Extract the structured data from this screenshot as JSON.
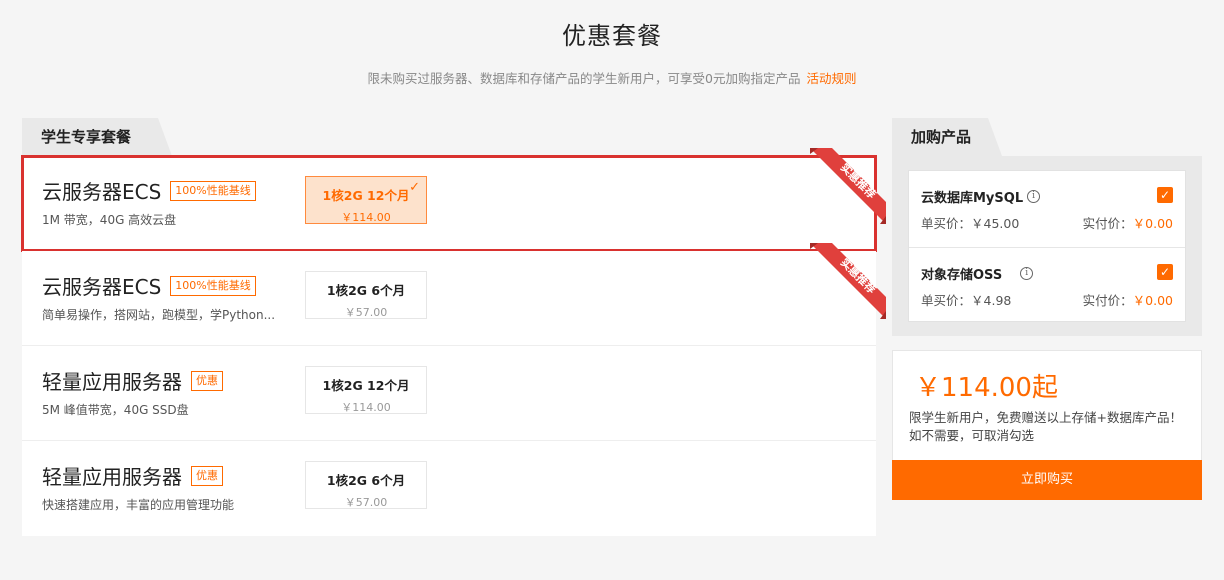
{
  "header": {
    "title": "优惠套餐",
    "subtitle": "限未购买过服务器、数据库和存储产品的学生新用户，可享受0元加购指定产品",
    "rules_link": "活动规则"
  },
  "left": {
    "tab_label": "学生专享套餐",
    "ribbon_text": "实惠推荐",
    "packages": [
      {
        "name": "云服务器ECS",
        "badge": "100%性能基线",
        "desc": "1M 带宽，40G 高效云盘",
        "spec_label": "1核2G 12个月",
        "spec_price": "￥114.00",
        "selected": true
      },
      {
        "name": "云服务器ECS",
        "badge": "100%性能基线",
        "desc": "简单易操作，搭网站，跑模型，学Python...",
        "spec_label": "1核2G 6个月",
        "spec_price": "￥57.00",
        "selected": false
      },
      {
        "name": "轻量应用服务器",
        "badge": "优惠",
        "desc": "5M 峰值带宽，40G SSD盘",
        "spec_label": "1核2G 12个月",
        "spec_price": "￥114.00",
        "selected": false
      },
      {
        "name": "轻量应用服务器",
        "badge": "优惠",
        "desc": "快速搭建应用，丰富的应用管理功能",
        "spec_label": "1核2G 6个月",
        "spec_price": "￥57.00",
        "selected": false
      }
    ]
  },
  "right": {
    "tab_label": "加购产品",
    "addons": [
      {
        "name": "云数据库MySQL",
        "unit_price_label": "单买价：",
        "unit_price": "￥45.00",
        "actual_label": "实付价：",
        "actual_price": "￥0.00"
      },
      {
        "name": "对象存储OSS",
        "unit_price_label": "单买价：",
        "unit_price": "￥4.98",
        "actual_label": "实付价：",
        "actual_price": "￥0.00"
      }
    ],
    "total": "￥114.00起",
    "note": "限学生新用户，免费赠送以上存储+数据库产品！如不需要，可取消勾选",
    "buy_label": "立即购买"
  },
  "colors": {
    "accent": "#ff6a00",
    "selection_outline": "#d9322f",
    "ribbon": "#e0403c"
  }
}
